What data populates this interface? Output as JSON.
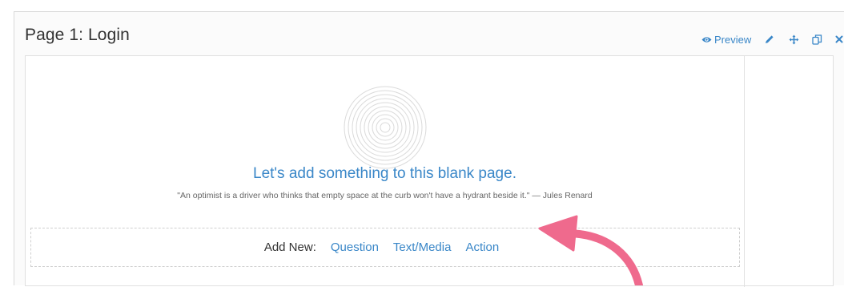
{
  "page": {
    "title": "Page 1: Login"
  },
  "toolbar": {
    "preview_label": "Preview",
    "icons": [
      "eye-icon",
      "pencil-icon",
      "move-icon",
      "copy-icon",
      "close-icon"
    ]
  },
  "empty_state": {
    "heading": "Let's add something to this blank page.",
    "quote": "\"An optimist is a driver who thinks that empty space at the curb won't have a hydrant beside it.\" — Jules Renard"
  },
  "add_new": {
    "label": "Add New:",
    "options": [
      "Question",
      "Text/Media",
      "Action"
    ]
  },
  "colors": {
    "link": "#3a87c8",
    "arrow": "#ef6a8d",
    "text": "#333333"
  }
}
